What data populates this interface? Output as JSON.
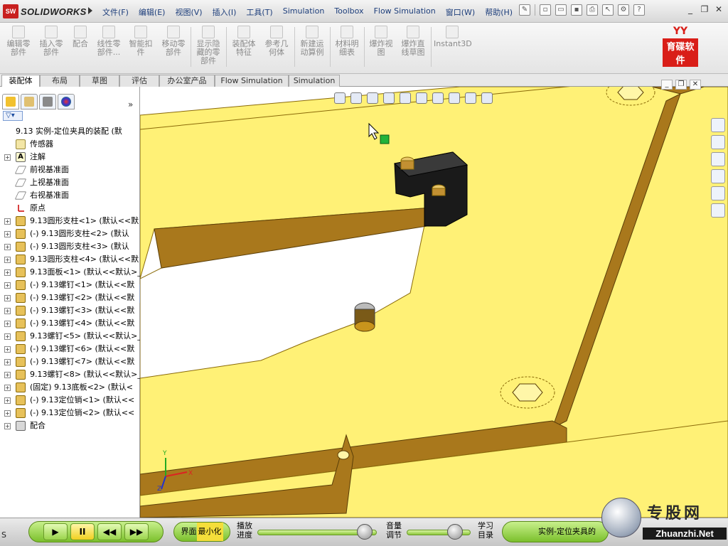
{
  "app": {
    "logo_mark": "SW",
    "logo_text": "SOLIDWORKS"
  },
  "menu": {
    "items": [
      "文件(F)",
      "编辑(E)",
      "视图(V)",
      "插入(I)",
      "工具(T)",
      "Simulation",
      "Toolbox",
      "Flow Simulation",
      "窗口(W)",
      "帮助(H)"
    ]
  },
  "commands": [
    {
      "label": "编辑零部件",
      "icon": "edit-component-icon"
    },
    {
      "label": "插入零部件",
      "icon": "insert-component-icon"
    },
    {
      "label": "配合",
      "icon": "mate-icon"
    },
    {
      "label": "线性零部件...",
      "icon": "linear-pattern-icon"
    },
    {
      "label": "智能扣件",
      "icon": "smart-fastener-icon"
    },
    {
      "label": "移动零部件",
      "icon": "move-component-icon"
    },
    {
      "label": "显示隐藏的零部件",
      "icon": "show-hidden-icon"
    },
    {
      "label": "装配体特征",
      "icon": "assembly-feature-icon"
    },
    {
      "label": "参考几何体",
      "icon": "reference-geometry-icon"
    },
    {
      "label": "新建运动算例",
      "icon": "motion-study-icon"
    },
    {
      "label": "材料明细表",
      "icon": "bom-icon"
    },
    {
      "label": "爆炸视图",
      "icon": "exploded-view-icon"
    },
    {
      "label": "爆炸直线草图",
      "icon": "explode-line-icon"
    },
    {
      "label": "Instant3D",
      "icon": "instant3d-icon"
    }
  ],
  "brand": {
    "top": "YY",
    "box": "育碟软件"
  },
  "tabs": [
    "装配体",
    "布局",
    "草图",
    "评估",
    "办公室产品",
    "Flow Simulation",
    "Simulation"
  ],
  "feature_tree": {
    "more": "»",
    "filter": "▽▾",
    "items": [
      {
        "label": "9.13 实例-定位夹具的装配  (默",
        "icon": "assembly",
        "expand": false
      },
      {
        "label": "传感器",
        "icon": "sensor",
        "expand": false
      },
      {
        "label": "注解",
        "icon": "note",
        "expand": true
      },
      {
        "label": "前视基准面",
        "icon": "plane",
        "expand": false
      },
      {
        "label": "上视基准面",
        "icon": "plane",
        "expand": false
      },
      {
        "label": "右视基准面",
        "icon": "plane",
        "expand": false
      },
      {
        "label": "原点",
        "icon": "origin",
        "expand": false
      },
      {
        "label": "9.13圆形支柱<1>  (默认<<默",
        "icon": "part",
        "expand": true
      },
      {
        "label": "(-) 9.13圆形支柱<2>  (默认",
        "icon": "part",
        "expand": true
      },
      {
        "label": "(-) 9.13圆形支柱<3>  (默认",
        "icon": "part",
        "expand": true
      },
      {
        "label": "9.13圆形支柱<4>  (默认<<默",
        "icon": "part",
        "expand": true
      },
      {
        "label": "9.13面板<1>  (默认<<默认>_",
        "icon": "part",
        "expand": true
      },
      {
        "label": "(-) 9.13螺钉<1>  (默认<<默",
        "icon": "part",
        "expand": true
      },
      {
        "label": "(-) 9.13螺钉<2>  (默认<<默",
        "icon": "part",
        "expand": true
      },
      {
        "label": "(-) 9.13螺钉<3>  (默认<<默",
        "icon": "part",
        "expand": true
      },
      {
        "label": "(-) 9.13螺钉<4>  (默认<<默",
        "icon": "part",
        "expand": true
      },
      {
        "label": "9.13螺钉<5>  (默认<<默认>_",
        "icon": "part",
        "expand": true
      },
      {
        "label": "(-) 9.13螺钉<6>  (默认<<默",
        "icon": "part",
        "expand": true
      },
      {
        "label": "(-) 9.13螺钉<7>  (默认<<默",
        "icon": "part",
        "expand": true
      },
      {
        "label": "9.13螺钉<8>  (默认<<默认>_",
        "icon": "part",
        "expand": true
      },
      {
        "label": "(固定) 9.13底板<2>  (默认<",
        "icon": "part",
        "expand": true
      },
      {
        "label": "(-) 9.13定位销<1>  (默认<<",
        "icon": "part",
        "expand": true
      },
      {
        "label": "(-) 9.13定位销<2>  (默认<<",
        "icon": "part",
        "expand": true
      },
      {
        "label": "配合",
        "icon": "mate",
        "expand": true
      }
    ]
  },
  "triad": {
    "x": "X",
    "y": "Y",
    "z": "Z"
  },
  "player": {
    "play": "▶",
    "pause": "II",
    "rewind": "◀◀",
    "forward": "▶▶",
    "minimize_prefix": "界面",
    "minimize_highlight": "最小化",
    "progress_label": "播放\n进度",
    "progress": 0.9,
    "volume_label": "音量\n调节",
    "volume": 0.75,
    "catalog_label": "学习\n目录",
    "chapter": "实例-定位夹具的"
  },
  "watermark": {
    "cn": "专股网",
    "url": "Zhuanzhi.Net"
  },
  "status_left": "S",
  "colors": {
    "part_yellow": "#fff176",
    "part_edge": "#8a6a08",
    "part_shadow": "#a9781c",
    "block_black": "#1a1a1a"
  }
}
